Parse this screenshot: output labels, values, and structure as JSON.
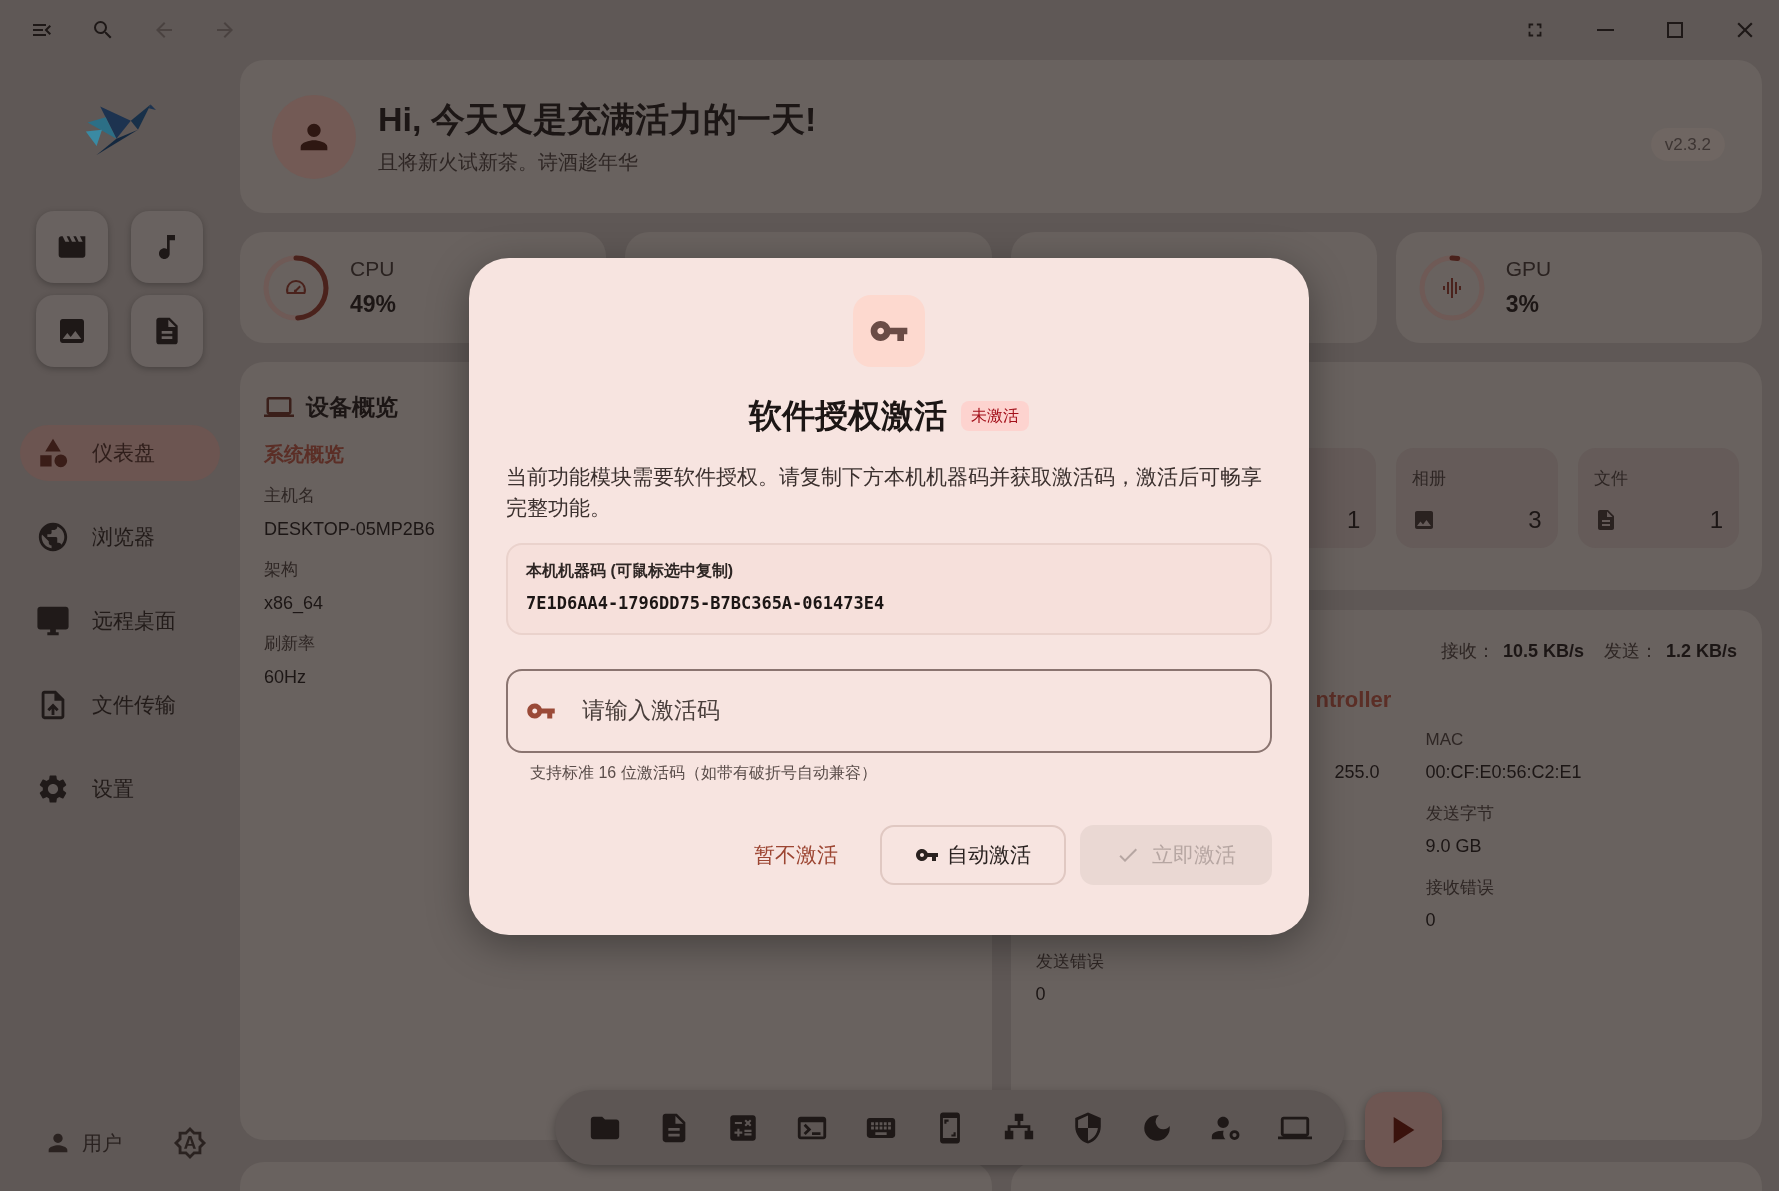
{
  "sidebar": {
    "nav_items": [
      {
        "label": "仪表盘",
        "selected": true
      },
      {
        "label": "浏览器",
        "selected": false
      },
      {
        "label": "远程桌面",
        "selected": false
      },
      {
        "label": "文件传输",
        "selected": false
      },
      {
        "label": "设置",
        "selected": false
      }
    ],
    "user_label": "用户"
  },
  "header": {
    "greeting": "Hi, 今天又是充满活力的一天!",
    "subtitle": "且将新火试新茶。诗酒趁年华",
    "version": "v2.3.2"
  },
  "stats": [
    {
      "label": "CPU",
      "value": "49%",
      "level": 0.49
    },
    {
      "label": "GPU",
      "value": "3%",
      "level": 0.03
    }
  ],
  "device": {
    "title": "设备概览",
    "section": "系统概览",
    "fields": [
      {
        "label": "主机名",
        "value": "DESKTOP-05MP2B6"
      },
      {
        "label": "架构",
        "value": "x86_64"
      },
      {
        "label": "刷新率",
        "value": "60Hz"
      }
    ]
  },
  "media_counts": [
    {
      "count": "1"
    },
    {
      "label": "相册",
      "count": "3"
    },
    {
      "label": "文件",
      "count": "1"
    }
  ],
  "network": {
    "receive_label": "接收：",
    "receive": "10.5 KB/s",
    "send_label": "发送：",
    "send": "1.2 KB/s",
    "adapter": "ntroller",
    "rows": [
      [
        {},
        {
          "value": "255.0"
        },
        {
          "label": "MAC",
          "value": "00:CF:E0:56:C2:E1"
        }
      ],
      [
        {},
        {},
        {
          "label": "发送字节",
          "value": "9.0 GB"
        }
      ],
      [
        {},
        {},
        {
          "label": "接收错误",
          "value": "0"
        }
      ],
      [
        {
          "label": "发送错误",
          "value": "0"
        },
        {},
        {}
      ]
    ]
  },
  "dialog": {
    "title": "软件授权激活",
    "status": "未激活",
    "activated": false,
    "description": "当前功能模块需要软件授权。请复制下方本机机器码并获取激活码，激活后可畅享完整功能。",
    "machine_code_label": "本机机器码 (可鼠标选中复制)",
    "machine_code": "7E1D6AA4-1796DD75-B7BC365A-061473E4",
    "input": {
      "placeholder": "请输入激活码"
    },
    "hint": "支持标准 16 位激活码（如带有破折号自动兼容）",
    "buttons": [
      {
        "label": "暂不激活",
        "kind": "text"
      },
      {
        "label": "自动激活",
        "kind": "outlined"
      },
      {
        "label": "立即激活",
        "kind": "primary",
        "disabled": true
      }
    ]
  }
}
